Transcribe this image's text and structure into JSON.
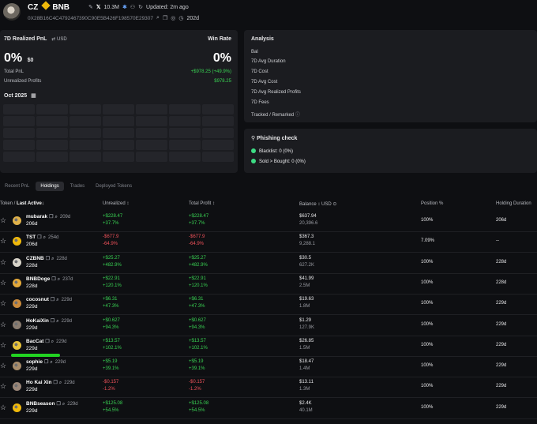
{
  "header": {
    "name": "CZ",
    "chain": "BNB",
    "followers": "10.3M",
    "updated": "Updated: 2m ago",
    "address": "0X28B16C4C4792467390C90E5B426F198570E29307",
    "age": "202d"
  },
  "pnl_card": {
    "title": "7D Realized PnL",
    "currency": "USD",
    "win_rate_label": "Win Rate",
    "pnl_pct": "0%",
    "pnl_usd": "$0",
    "win_rate": "0%",
    "total_pnl_label": "Total PnL",
    "total_pnl_value": "+$978.25 (+49.9%)",
    "unrealized_label": "Unrealized Profits",
    "unrealized_value": "$978.25",
    "month": "Oct 2025"
  },
  "analysis": {
    "title": "Analysis",
    "rows": [
      "Bal",
      "7D Avg Duration",
      "7D Cost",
      "7D Avg Cost",
      "7D Avg Realized Profits",
      "7D Fees",
      "Tracked / Remarked"
    ]
  },
  "phishing": {
    "title": "Phishing check",
    "blacklist": "Blacklist: 0 (0%)",
    "sold": "Sold > Bought: 0 (0%)"
  },
  "tabs": [
    "Recent PnL",
    "Holdings",
    "Trades",
    "Deployed Tokens"
  ],
  "table": {
    "headers": {
      "token": "Token",
      "last_active": "Last Active",
      "unrealized": "Unrealized",
      "total_profit": "Total Profit",
      "balance": "Balance",
      "usd": "USD",
      "position": "Position %",
      "holding": "Holding Duration"
    },
    "rows": [
      {
        "name": "mubarak",
        "age_small": "209d",
        "age": "206d",
        "unr": "+$228.47",
        "unr_pct": "+37.7%",
        "tot": "+$228.47",
        "tot_pct": "+37.7%",
        "bal": "$637.94",
        "bal2": "20,396.6",
        "pos": "100%",
        "hold": "206d",
        "neg": false,
        "icon": "#e0b24a"
      },
      {
        "name": "TST",
        "age_small": "254d",
        "age": "206d",
        "unr": "-$677.9",
        "unr_pct": "-64.9%",
        "tot": "-$677.9",
        "tot_pct": "-64.9%",
        "bal": "$367.3",
        "bal2": "9,288.1",
        "pos": "7.09%",
        "hold": "--",
        "neg": true,
        "icon": "#f0b90b"
      },
      {
        "name": "CZBNB",
        "age_small": "228d",
        "age": "228d",
        "unr": "+$25.27",
        "unr_pct": "+482.9%",
        "tot": "+$25.27",
        "tot_pct": "+482.9%",
        "bal": "$30.5",
        "bal2": "627.2K",
        "pos": "100%",
        "hold": "228d",
        "neg": false,
        "icon": "#d8d4ca"
      },
      {
        "name": "BNBDoge",
        "age_small": "237d",
        "age": "228d",
        "unr": "+$22.91",
        "unr_pct": "+120.1%",
        "tot": "+$22.91",
        "tot_pct": "+120.1%",
        "bal": "$41.99",
        "bal2": "2.5M",
        "pos": "100%",
        "hold": "228d",
        "neg": false,
        "icon": "#e4a93a"
      },
      {
        "name": "cocosnut",
        "age_small": "229d",
        "age": "229d",
        "unr": "+$6.31",
        "unr_pct": "+47.3%",
        "tot": "+$6.31",
        "tot_pct": "+47.3%",
        "bal": "$19.63",
        "bal2": "1.8M",
        "pos": "100%",
        "hold": "229d",
        "neg": false,
        "icon": "#c98a3c"
      },
      {
        "name": "HoKaiXin",
        "age_small": "229d",
        "age": "229d",
        "unr": "+$0.627",
        "unr_pct": "+94.3%",
        "tot": "+$0.627",
        "tot_pct": "+94.3%",
        "bal": "$1.29",
        "bal2": "127.9K",
        "pos": "100%",
        "hold": "229d",
        "neg": false,
        "icon": "#8a7c70"
      },
      {
        "name": "BacCat",
        "age_small": "229d",
        "age": "229d",
        "unr": "+$13.57",
        "unr_pct": "+102.1%",
        "tot": "+$13.57",
        "tot_pct": "+102.1%",
        "bal": "$26.85",
        "bal2": "1.5M",
        "pos": "100%",
        "hold": "229d",
        "neg": false,
        "icon": "#e8c23a"
      },
      {
        "name": "sophie",
        "age_small": "229d",
        "age": "229d",
        "unr": "+$5.19",
        "unr_pct": "+39.1%",
        "tot": "+$5.19",
        "tot_pct": "+39.1%",
        "bal": "$18.47",
        "bal2": "1.4M",
        "pos": "100%",
        "hold": "229d",
        "neg": false,
        "icon": "#a88c6a"
      },
      {
        "name": "Ho Kai Xin",
        "age_small": "229d",
        "age": "229d",
        "unr": "-$0.157",
        "unr_pct": "-1.2%",
        "tot": "-$0.157",
        "tot_pct": "-1.2%",
        "bal": "$13.11",
        "bal2": "1.3M",
        "pos": "100%",
        "hold": "229d",
        "neg": true,
        "icon": "#9a8678"
      },
      {
        "name": "BNBseason",
        "age_small": "229d",
        "age": "229d",
        "unr": "+$125.08",
        "unr_pct": "+54.5%",
        "tot": "+$125.08",
        "tot_pct": "+54.5%",
        "bal": "$2.4K",
        "bal2": "40.1M",
        "pos": "100%",
        "hold": "229d",
        "neg": false,
        "icon": "#f0b90b"
      }
    ]
  },
  "colors": {
    "positive": "#39d353",
    "negative": "#f0525a",
    "bnb": "#f0b90b",
    "highlight": "#22d322"
  }
}
